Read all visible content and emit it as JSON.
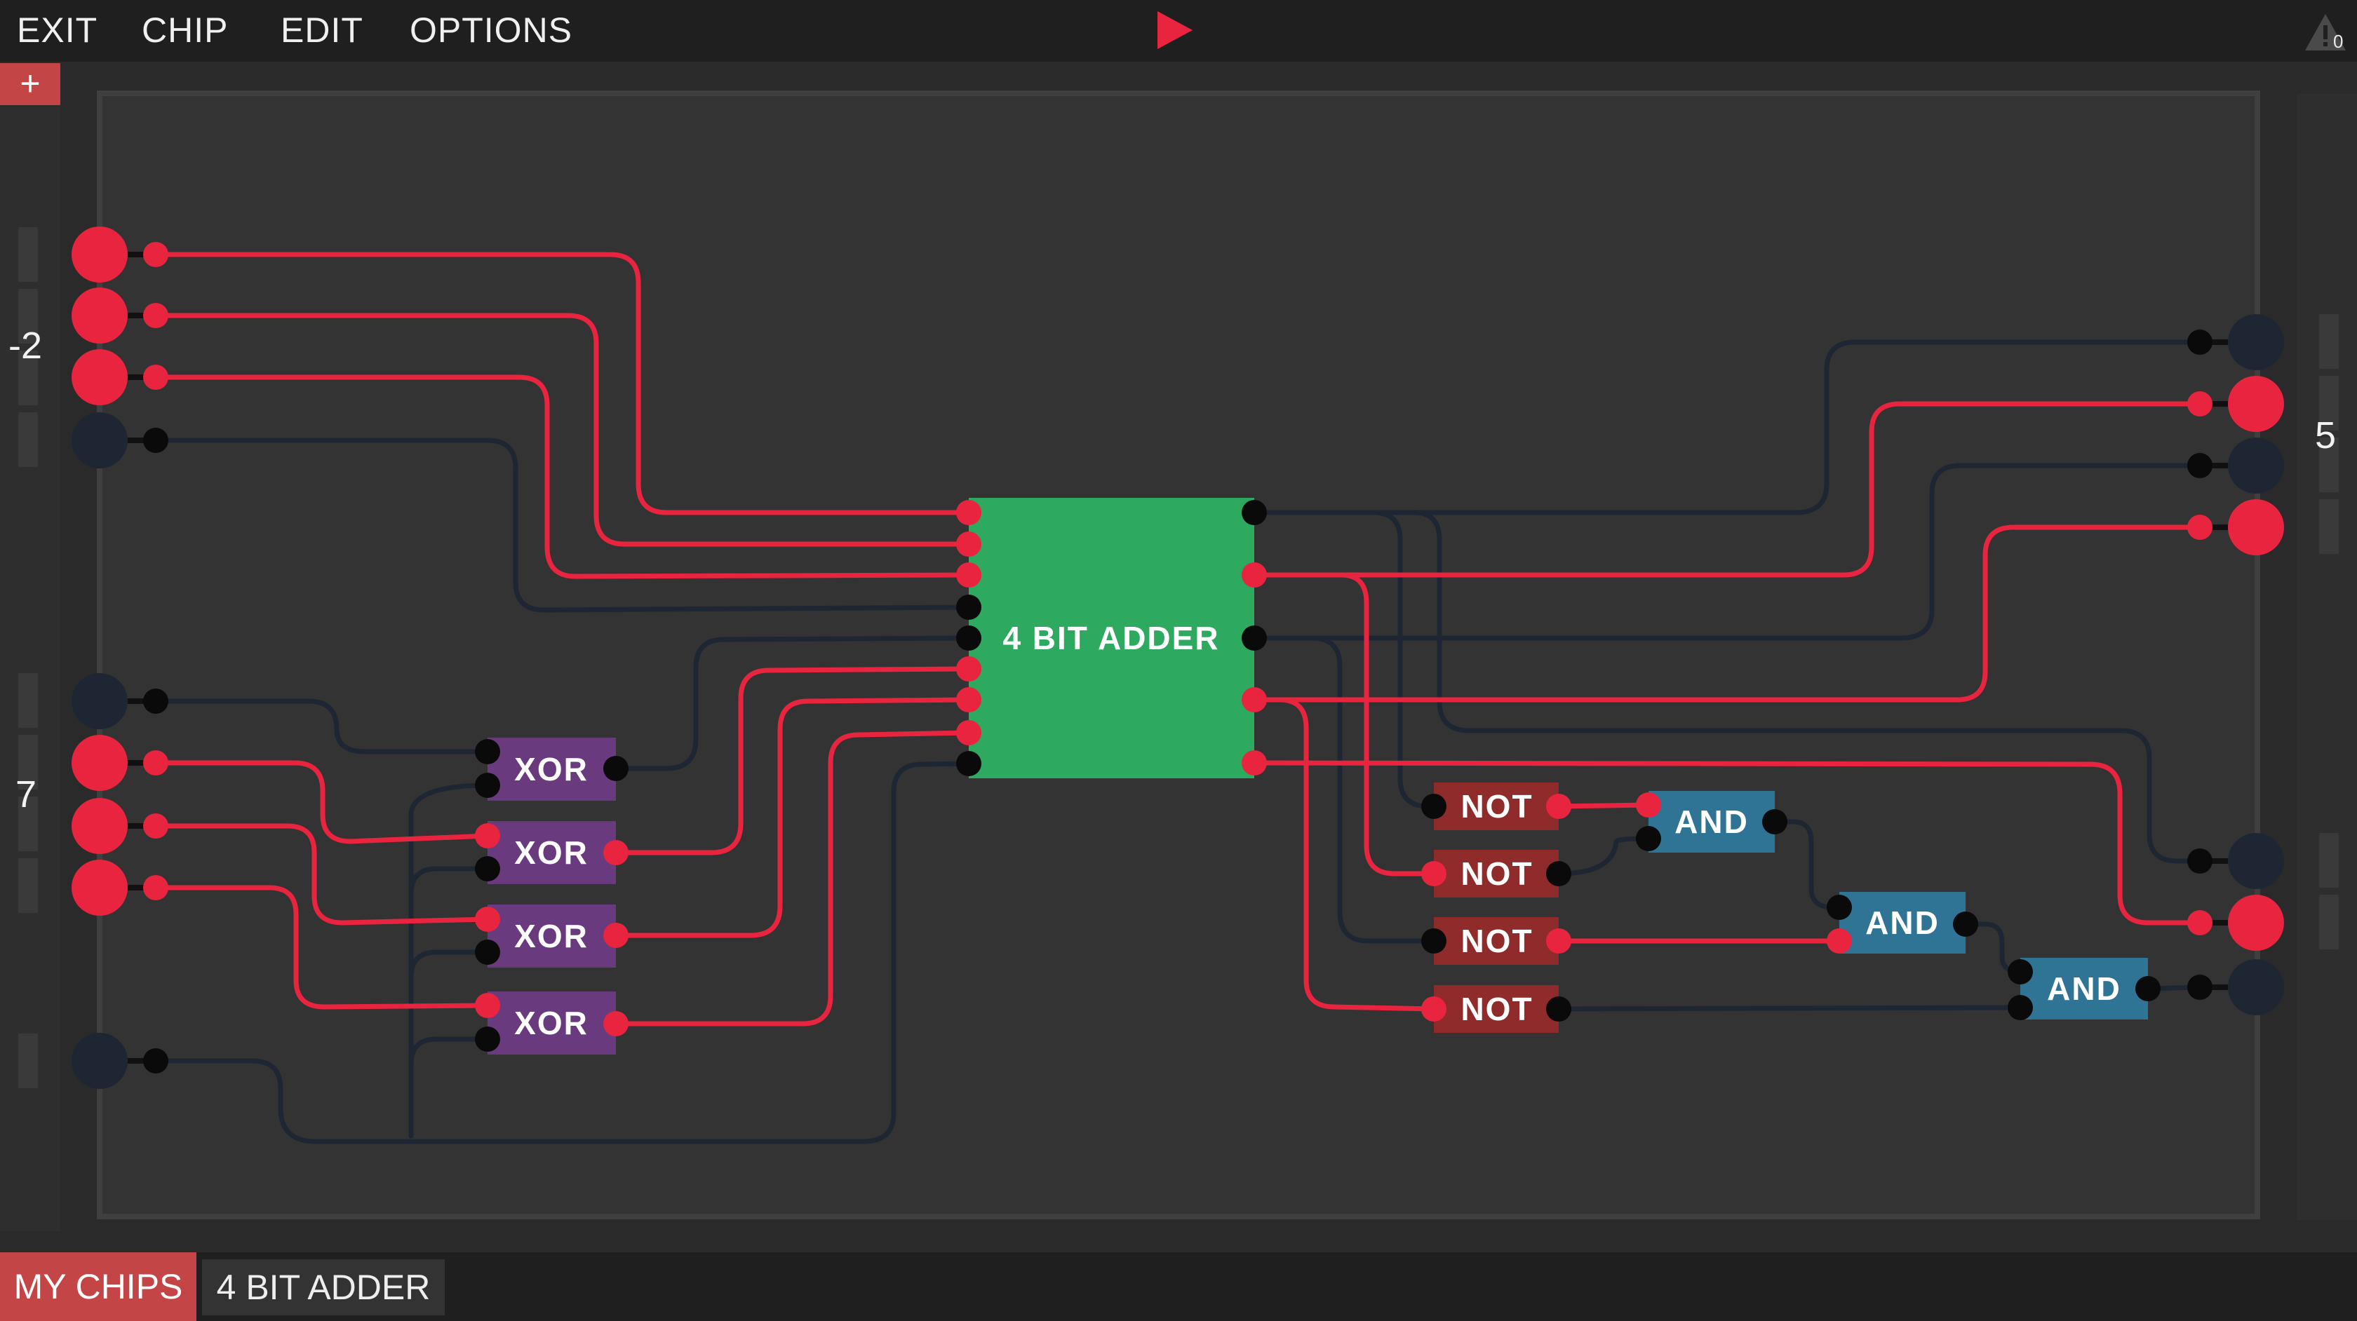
{
  "menu": {
    "exit": "EXIT",
    "chip": "CHIP",
    "edit": "EDIT",
    "options": "OPTIONS"
  },
  "colors": {
    "on": "#e8243e",
    "off": "#1e2633",
    "adder": "#2daa60",
    "xor": "#6a3a7e",
    "not": "#8f2b2b",
    "and": "#2f7494",
    "accent": "#c44545"
  },
  "toolbar": {
    "add_label": "+",
    "warning_count": "0"
  },
  "bus": {
    "input_a_value": "-2",
    "input_b_value": "7",
    "output_value": "5"
  },
  "chips": {
    "adder": "4 BIT ADDER",
    "xor": [
      "XOR",
      "XOR",
      "XOR",
      "XOR"
    ],
    "not": [
      "NOT",
      "NOT",
      "NOT",
      "NOT"
    ],
    "and": [
      "AND",
      "AND",
      "AND"
    ]
  },
  "bottom": {
    "my_chips": "MY CHIPS",
    "saved_chip": "4 BIT ADDER"
  }
}
